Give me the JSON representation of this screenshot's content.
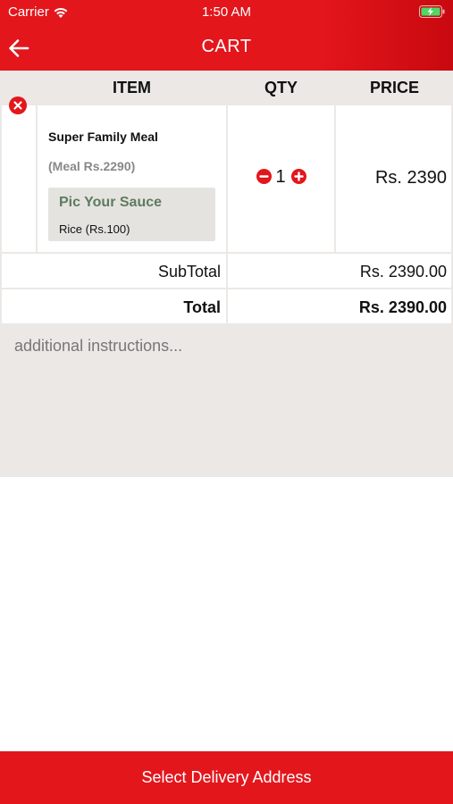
{
  "status_bar": {
    "carrier": "Carrier",
    "time": "1:50 AM",
    "wifi_icon": "wifi-icon",
    "battery_icon": "battery-charging-icon"
  },
  "nav": {
    "title": "CART",
    "back_icon": "arrow-left-icon"
  },
  "columns": {
    "item": "ITEM",
    "qty": "QTY",
    "price": "PRICE"
  },
  "cart_items": [
    {
      "name": "Super Family Meal",
      "meal_price": "(Meal Rs.2290)",
      "addon_title": "Pic Your Sauce",
      "addon_option": "Rice (Rs.100)",
      "qty": "1",
      "price": "Rs. 2390"
    }
  ],
  "summary": {
    "subtotal_label": "SubTotal",
    "subtotal_value": "Rs. 2390.00",
    "total_label": "Total",
    "total_value": "Rs. 2390.00"
  },
  "instructions": {
    "placeholder": "additional instructions..."
  },
  "footer": {
    "button_label": "Select Delivery Address"
  },
  "colors": {
    "brand_red": "#e3161c",
    "addon_green": "#5d7c5f",
    "panel_gray": "#ebe8e6"
  }
}
